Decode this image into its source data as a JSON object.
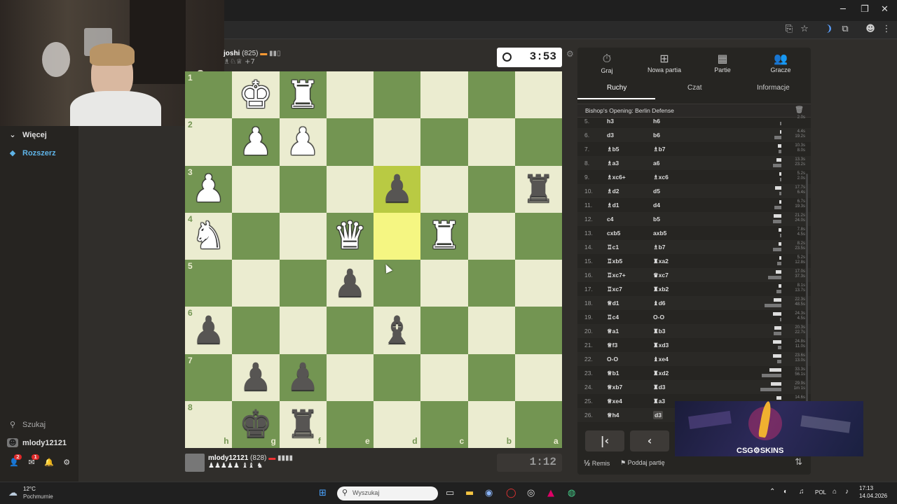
{
  "sidebar": {
    "more_label": "Więcej",
    "expand_label": "Rozszerz",
    "search_label": "Szukaj",
    "username": "mlody12121",
    "friends_badge": "2",
    "messages_badge": "1"
  },
  "top_player": {
    "name": "joshi",
    "rating": "(825)",
    "captured_extra": "+7"
  },
  "bottom_player": {
    "name": "mlody12121",
    "rating": "(828)"
  },
  "clocks": {
    "top": "3:53",
    "bottom": "1:12"
  },
  "board": {
    "orientation": "black",
    "rank_labels": [
      "1",
      "2",
      "3",
      "4",
      "5",
      "6",
      "7",
      "8"
    ],
    "file_labels": [
      "h",
      "g",
      "f",
      "e",
      "d",
      "c",
      "b",
      "a"
    ],
    "highlight": [
      "d3",
      "d4"
    ],
    "pieces": [
      {
        "sq": "g1",
        "type": "king",
        "color": "white",
        "glyph": "♚"
      },
      {
        "sq": "f1",
        "type": "rook",
        "color": "white",
        "glyph": "♜"
      },
      {
        "sq": "g2",
        "type": "pawn",
        "color": "white",
        "glyph": "♟"
      },
      {
        "sq": "f2",
        "type": "pawn",
        "color": "white",
        "glyph": "♟"
      },
      {
        "sq": "h3",
        "type": "pawn",
        "color": "white",
        "glyph": "♟"
      },
      {
        "sq": "d3",
        "type": "pawn",
        "color": "black",
        "glyph": "♟"
      },
      {
        "sq": "a3",
        "type": "rook",
        "color": "black",
        "glyph": "♜"
      },
      {
        "sq": "h4",
        "type": "knight",
        "color": "white",
        "glyph": "♞"
      },
      {
        "sq": "e4",
        "type": "queen",
        "color": "white",
        "glyph": "♛"
      },
      {
        "sq": "c4",
        "type": "rook",
        "color": "white",
        "glyph": "♜"
      },
      {
        "sq": "e5",
        "type": "pawn",
        "color": "black",
        "glyph": "♟"
      },
      {
        "sq": "h6",
        "type": "pawn",
        "color": "black",
        "glyph": "♟"
      },
      {
        "sq": "d6",
        "type": "bishop",
        "color": "black",
        "glyph": "♝"
      },
      {
        "sq": "g7",
        "type": "pawn",
        "color": "black",
        "glyph": "♟"
      },
      {
        "sq": "f7",
        "type": "pawn",
        "color": "black",
        "glyph": "♟"
      },
      {
        "sq": "g8",
        "type": "king",
        "color": "black",
        "glyph": "♚"
      },
      {
        "sq": "f8",
        "type": "rook",
        "color": "black",
        "glyph": "♜"
      }
    ]
  },
  "panel": {
    "tabs": [
      {
        "label": "Graj",
        "icon": "stopwatch-icon",
        "glyph": "⏱"
      },
      {
        "label": "Nowa partia",
        "icon": "plus-square-icon",
        "glyph": "⊞"
      },
      {
        "label": "Partie",
        "icon": "board-icon",
        "glyph": "▦"
      },
      {
        "label": "Gracze",
        "icon": "players-icon",
        "glyph": "👥"
      }
    ],
    "subtabs": [
      "Ruchy",
      "Czat",
      "Informacje"
    ],
    "opening": "Bishop's Opening: Berlin Defense",
    "moves": [
      {
        "n": "5.",
        "w": "h3",
        "b": "h6",
        "tw": "",
        "tb": "2.0s"
      },
      {
        "n": "6.",
        "w": "d3",
        "b": "b6",
        "tw": "4.4s",
        "tb": "19.2s"
      },
      {
        "n": "7.",
        "w": "♗b5",
        "b": "♗b7",
        "tw": "10.3s",
        "tb": "8.0s"
      },
      {
        "n": "8.",
        "w": "♗a3",
        "b": "a6",
        "tw": "13.3s",
        "tb": "23.2s"
      },
      {
        "n": "9.",
        "w": "♗xc6+",
        "b": "♗xc6",
        "tw": "5.2s",
        "tb": "2.0s"
      },
      {
        "n": "10.",
        "w": "♗d2",
        "b": "d5",
        "tw": "17.7s",
        "tb": "6.4s"
      },
      {
        "n": "11.",
        "w": "♗d1",
        "b": "d4",
        "tw": "6.7s",
        "tb": "19.3s"
      },
      {
        "n": "12.",
        "w": "c4",
        "b": "b5",
        "tw": "21.2s",
        "tb": "24.0s"
      },
      {
        "n": "13.",
        "w": "cxb5",
        "b": "axb5",
        "tw": "7.8s",
        "tb": "4.5s"
      },
      {
        "n": "14.",
        "w": "♖c1",
        "b": "♗b7",
        "tw": "8.2s",
        "tb": "23.5s"
      },
      {
        "n": "15.",
        "w": "♖xb5",
        "b": "♜xa2",
        "tw": "5.2s",
        "tb": "12.8s"
      },
      {
        "n": "16.",
        "w": "♖xc7+",
        "b": "♛xc7",
        "tw": "17.0s",
        "tb": "37.3s"
      },
      {
        "n": "17.",
        "w": "♖xc7",
        "b": "♜xb2",
        "tw": "8.1s",
        "tb": "13.7s"
      },
      {
        "n": "18.",
        "w": "♕d1",
        "b": "♝d6",
        "tw": "22.3s",
        "tb": "48.5s"
      },
      {
        "n": "19.",
        "w": "♖c4",
        "b": "O-O",
        "tw": "24.3s",
        "tb": "4.5s"
      },
      {
        "n": "20.",
        "w": "♕a1",
        "b": "♜b3",
        "tw": "20.3s",
        "tb": "22.7s"
      },
      {
        "n": "21.",
        "w": "♕f3",
        "b": "♜xd3",
        "tw": "24.8s",
        "tb": "11.0s"
      },
      {
        "n": "22.",
        "w": "O-O",
        "b": "♝xe4",
        "tw": "23.6s",
        "tb": "13.0s"
      },
      {
        "n": "23.",
        "w": "♕b1",
        "b": "♜xd2",
        "tw": "33.3s",
        "tb": "56.1s"
      },
      {
        "n": "24.",
        "w": "♕xb7",
        "b": "♜d3",
        "tw": "29.9s",
        "tb": "1m 1s"
      },
      {
        "n": "25.",
        "w": "♕xe4",
        "b": "♜a3",
        "tw": "14.6s",
        "tb": ""
      },
      {
        "n": "26.",
        "w": "♕h4",
        "b": "d3",
        "tw": "",
        "tb": ""
      }
    ],
    "remis_label": "Remis",
    "resign_label": "Poddaj partię"
  },
  "ad": {
    "brand": "CSG⚙SKINS"
  },
  "taskbar": {
    "weather_temp": "12°C",
    "weather_desc": "Pochmurnie",
    "search_placeholder": "Wyszukaj",
    "lang": "POL",
    "time": "17:13",
    "date": "14.04.2026"
  },
  "colors": {
    "light_square": "#ebecd0",
    "dark_square": "#739552",
    "highlight": "#f5f682"
  }
}
